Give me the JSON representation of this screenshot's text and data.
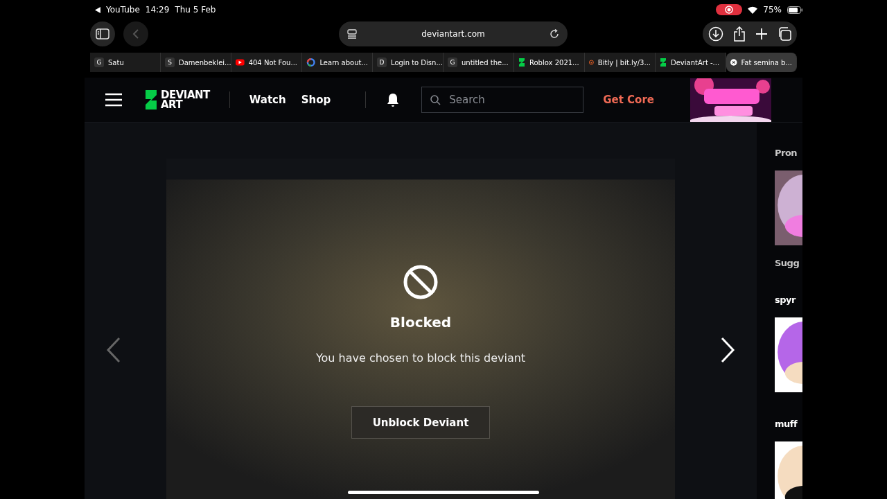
{
  "status_bar": {
    "back_app": "YouTube",
    "time": "14:29",
    "date": "Thu 5 Feb",
    "battery": "75%",
    "recording": true
  },
  "browser": {
    "url": "deviantart.com",
    "tabs": [
      {
        "label": "Satu",
        "kind": "letter",
        "letter": "G",
        "selected": false
      },
      {
        "label": "Damenbeklei...",
        "kind": "letter",
        "letter": "S",
        "selected": false
      },
      {
        "label": "404 Not Fou...",
        "kind": "video",
        "selected": false
      },
      {
        "label": "Learn about...",
        "kind": "google",
        "selected": false
      },
      {
        "label": "Login to Disn...",
        "kind": "letter",
        "letter": "D",
        "selected": false
      },
      {
        "label": "untitled the...",
        "kind": "letter",
        "letter": "G",
        "selected": false
      },
      {
        "label": "Roblox 2021...",
        "kind": "deviant",
        "selected": false
      },
      {
        "label": "Bitly | bit.ly/3...",
        "kind": "bitly",
        "selected": false
      },
      {
        "label": "DeviantArt -...",
        "kind": "deviant",
        "selected": false
      },
      {
        "label": "Fat semina b...",
        "kind": "close",
        "selected": true
      }
    ]
  },
  "site_header": {
    "logo_lines": [
      "DEVIANT",
      "ART"
    ],
    "nav": [
      "Watch",
      "Shop"
    ],
    "search": {
      "placeholder": "Search"
    },
    "get_core": "Get Core",
    "promo": {
      "kind": "picture"
    }
  },
  "viewer": {
    "title": "Blocked",
    "message": "You have chosen to block this deviant",
    "button": "Unblock Deviant"
  },
  "sidebar": {
    "items": [
      {
        "kind": "heading",
        "text": "Pron"
      },
      {
        "kind": "picture"
      },
      {
        "kind": "heading",
        "text": "Sugg"
      },
      {
        "kind": "name",
        "text": "spyr"
      },
      {
        "kind": "picture"
      },
      {
        "kind": "name",
        "text": "muff"
      },
      {
        "kind": "picture"
      }
    ]
  }
}
